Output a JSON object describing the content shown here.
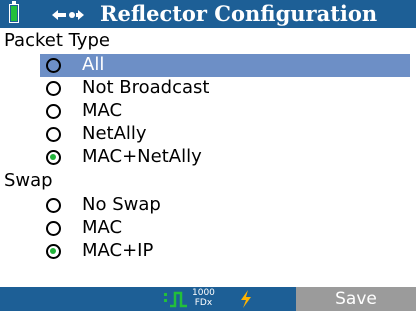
{
  "window": {
    "title": "Reflector Configuration"
  },
  "icons": {
    "battery": "battery-icon",
    "network": "network-link-icon",
    "link": "link-status-icon",
    "power": "lightning-icon"
  },
  "colors": {
    "titlebar": "#1d5f96",
    "selection": "#6d8fc6",
    "radio_checked": "#22b33a",
    "save_disabled": "#9b9b9b"
  },
  "packet_type": {
    "heading": "Packet Type",
    "options": [
      {
        "label": "All",
        "selected": true,
        "checked": false
      },
      {
        "label": "Not Broadcast",
        "selected": false,
        "checked": false
      },
      {
        "label": "MAC",
        "selected": false,
        "checked": false
      },
      {
        "label": "NetAlly",
        "selected": false,
        "checked": false
      },
      {
        "label": "MAC+NetAlly",
        "selected": false,
        "checked": true
      }
    ]
  },
  "swap": {
    "heading": "Swap",
    "options": [
      {
        "label": "No Swap",
        "checked": false
      },
      {
        "label": "MAC",
        "checked": false
      },
      {
        "label": "MAC+IP",
        "checked": true
      }
    ]
  },
  "status": {
    "speed": "1000",
    "duplex": "FDx"
  },
  "softkeys": {
    "save_label": "Save"
  }
}
